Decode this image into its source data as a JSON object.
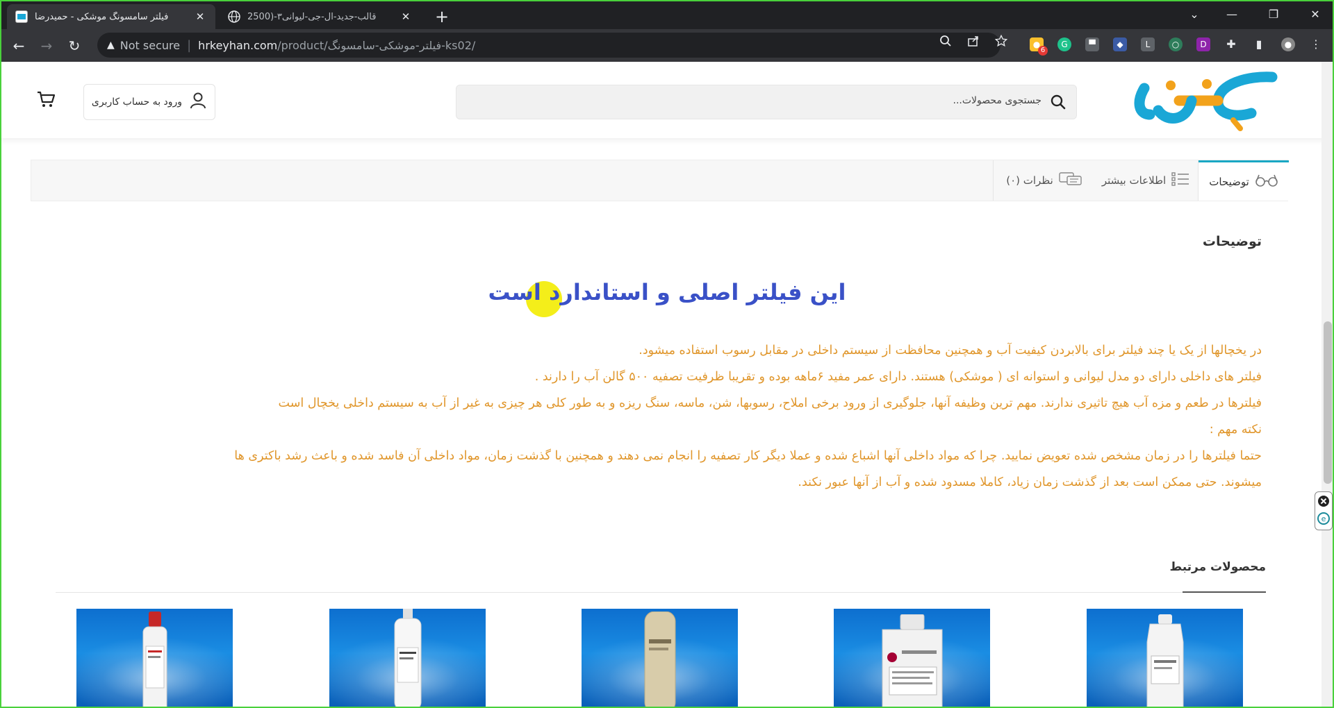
{
  "browser": {
    "tabs": [
      {
        "title": "فیلتر سامسونگ موشکی - حمیدرضا",
        "close": "✕",
        "active": true
      },
      {
        "title": "قالب-جدید-ال-جی-لیوانی۳-(2500",
        "close": "✕",
        "active": false
      }
    ],
    "new_tab": "+",
    "window": {
      "dropdown": "⌄",
      "minimize": "—",
      "maximize": "❐",
      "close": "✕"
    },
    "nav": {
      "back": "←",
      "forward": "→",
      "reload": "↻"
    },
    "security_label": "Not secure",
    "url_host": "hrkeyhan.com",
    "url_path": "/product/فیلتر-موشکی-سامسونگ-ks02/",
    "extension_badge": "6",
    "extension_letters": [
      "L",
      "D"
    ]
  },
  "header": {
    "search_placeholder": "جستجوی محصولات...",
    "login_label": "ورود به حساب کاربری"
  },
  "product_tabs": [
    {
      "label": "توضیحات",
      "active": true
    },
    {
      "label": "اطلاعات بیشتر",
      "active": false
    },
    {
      "label": "نظرات (۰)",
      "active": false
    }
  ],
  "description": {
    "section_title": "توضیحات",
    "headline": "این فیلتر اصلی و استاندارد است",
    "lines": [
      "در یخچالها از یک یا چند فیلتر برای بالابردن کیفیت آب و همچنین محافظت از سیستم داخلی در مقابل رسوب استفاده میشود.",
      "فیلتر های داخلی دارای دو مدل لیوانی و استوانه ای ( موشکی) هستند. دارای عمر مفید ۶ماهه بوده و تقریبا ظرفیت تصفیه ۵۰۰ گالن آب را دارند .",
      "فیلترها در طعم و مزه آب هیچ تاثیری ندارند. مهم ترین وظیفه آنها، جلوگیری از ورود برخی املاح، رسوبها، شن، ماسه، سنگ ریزه و به طور کلی هر چیزی به غیر از آب به سیستم داخلی یخچال است",
      "نکته مهم :",
      "حتما فیلترها را در زمان مشخص شده تعویض نمایید. چرا که مواد داخلی آنها اشباع شده و عملا دیگر کار تصفیه را انجام نمی دهند و همچنین با گذشت زمان، مواد داخلی آن فاسد شده و باعث رشد باکتری ها",
      "میشوند. حتی ممکن است بعد از گذشت زمان زیاد، کاملا مسدود شده و آب از آنها عبور نکند."
    ]
  },
  "related": {
    "title": "محصولات مرتبط",
    "products": [
      {
        "name": "product-samsung-cup-filter"
      },
      {
        "name": "product-lg-cup-filter"
      },
      {
        "name": "product-beige-cylinder-filter"
      },
      {
        "name": "product-white-cylinder-filter"
      },
      {
        "name": "product-red-cap-filter"
      }
    ]
  },
  "colors": {
    "headline": "#3a51c7",
    "paragraph": "#e0962b",
    "accent": "#1aa7c4",
    "logo_blue": "#1aa7d6",
    "logo_orange": "#f2a21b"
  }
}
